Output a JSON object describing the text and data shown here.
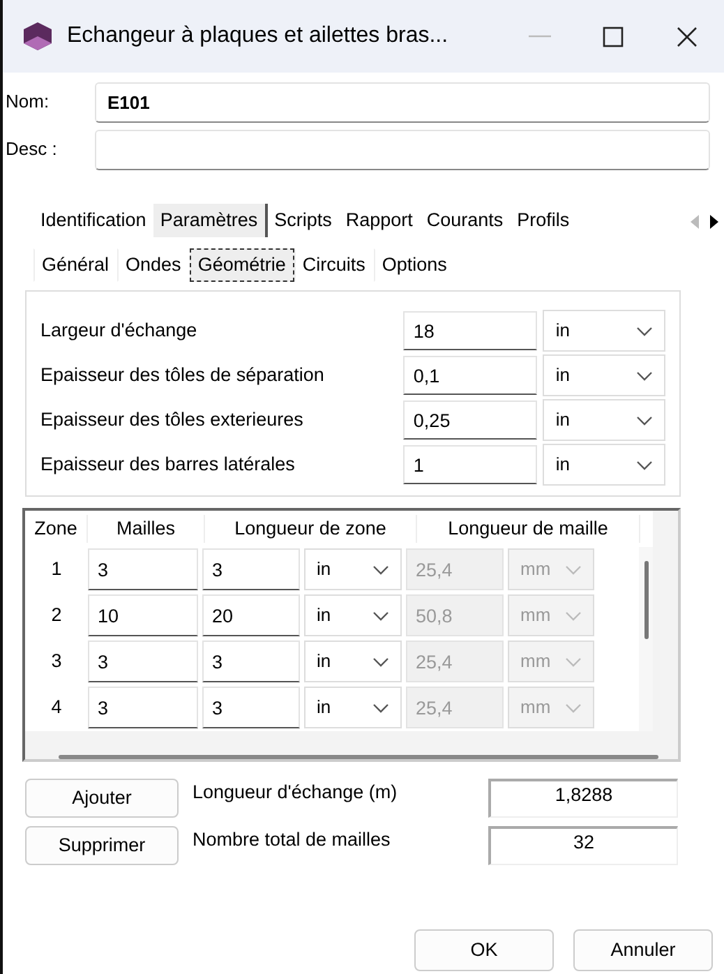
{
  "window": {
    "title": "Echangeur à plaques et ailettes bras..."
  },
  "nom": {
    "label": "Nom:",
    "value": "E101"
  },
  "desc": {
    "label": "Desc :"
  },
  "tabs": [
    {
      "label": "Identification",
      "selected": false
    },
    {
      "label": "Paramètres",
      "selected": true
    },
    {
      "label": "Scripts",
      "selected": false
    },
    {
      "label": "Rapport",
      "selected": false
    },
    {
      "label": "Courants",
      "selected": false
    },
    {
      "label": "Profils",
      "selected": false
    }
  ],
  "subtabs": [
    {
      "label": "Général",
      "selected": false
    },
    {
      "label": "Ondes",
      "selected": false
    },
    {
      "label": "Géométrie",
      "selected": true
    },
    {
      "label": "Circuits",
      "selected": false
    },
    {
      "label": "Options",
      "selected": false
    }
  ],
  "parameters": [
    {
      "label": "Largeur d'échange",
      "value": "18",
      "unit": "in"
    },
    {
      "label": "Epaisseur des tôles de séparation",
      "value": "0,1",
      "unit": "in"
    },
    {
      "label": "Epaisseur des tôles exterieures",
      "value": "0,25",
      "unit": "in"
    },
    {
      "label": "Epaisseur des barres latérales",
      "value": "1",
      "unit": "in"
    }
  ],
  "table": {
    "columns": [
      {
        "label": "Zone"
      },
      {
        "label": "Mailles"
      },
      {
        "label": "Longueur de zone"
      },
      {
        "label": "Longueur de maille",
        "disabled": true
      }
    ],
    "rows": [
      {
        "zone": "1",
        "mailles": "3",
        "longueur_zone": "3",
        "zone_unit": "in",
        "longueur_maille": "25,4",
        "maille_unit": "mm"
      },
      {
        "zone": "2",
        "mailles": "10",
        "longueur_zone": "20",
        "zone_unit": "in",
        "longueur_maille": "50,8",
        "maille_unit": "mm"
      },
      {
        "zone": "3",
        "mailles": "3",
        "longueur_zone": "3",
        "zone_unit": "in",
        "longueur_maille": "25,4",
        "maille_unit": "mm"
      },
      {
        "zone": "4",
        "mailles": "3",
        "longueur_zone": "3",
        "zone_unit": "in",
        "longueur_maille": "25,4",
        "maille_unit": "mm"
      }
    ]
  },
  "row_buttons": [
    "Ajouter",
    "Supprimer"
  ],
  "summary": [
    {
      "label": "Longueur d'échange (m)",
      "value": "1,8288"
    },
    {
      "label": "Nombre total de mailles",
      "value": "32"
    }
  ],
  "dialog_buttons": [
    "OK",
    "Annuler"
  ]
}
